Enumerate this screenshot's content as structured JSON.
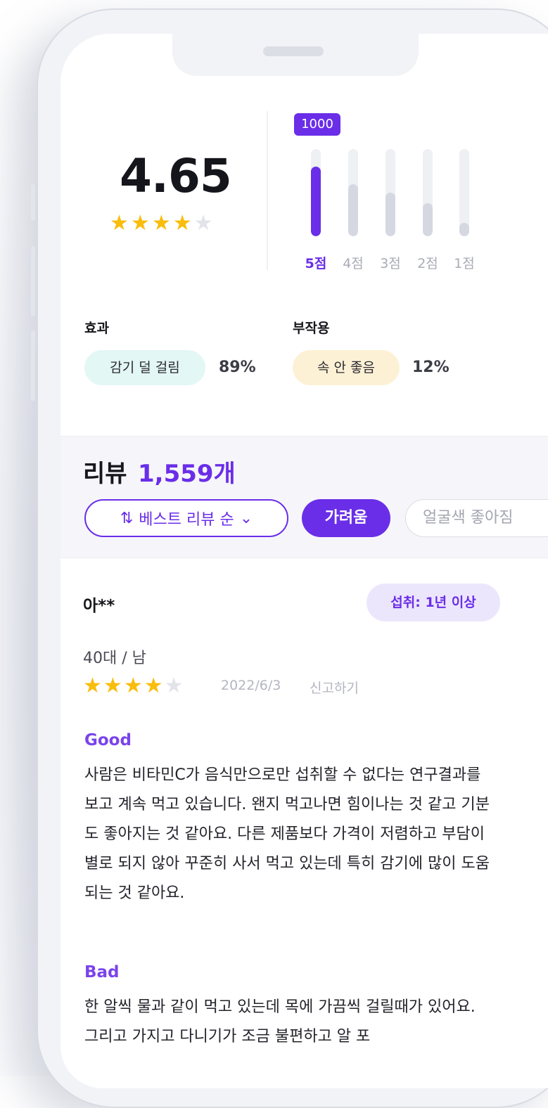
{
  "rating": {
    "score": "4.65",
    "stars_filled": 4,
    "stars_total": 5,
    "top_count_badge": "1000"
  },
  "distribution": [
    {
      "label": "5점",
      "fraction": 0.8,
      "active": true
    },
    {
      "label": "4점",
      "fraction": 0.6,
      "active": false
    },
    {
      "label": "3점",
      "fraction": 0.5,
      "active": false
    },
    {
      "label": "2점",
      "fraction": 0.38,
      "active": false
    },
    {
      "label": "1점",
      "fraction": 0.15,
      "active": false
    }
  ],
  "effects": {
    "effect_title": "효과",
    "effect_chip": "감기 덜 걸림",
    "effect_pct": "89%",
    "side_title": "부작용",
    "side_chip": "속 안 좋음",
    "side_pct": "12%"
  },
  "reviews": {
    "title": "리뷰",
    "count": "1,559개",
    "sort_label": "베스트 리뷰 순",
    "filter_active": "가려움",
    "filter_next": "얼굴색 좋아짐"
  },
  "review": {
    "user": "아**",
    "intake": "섭취: 1년 이상",
    "demographic": "40대 / 남",
    "stars_filled": 4,
    "date": "2022/6/3",
    "report": "신고하기",
    "good_label": "Good",
    "good_text": "사람은 비타민C가 음식만으로만 섭취할 수 없다는 연구결과를 보고 계속 먹고 있습니다. 왠지 먹고나면 힘이나는 것 같고 기분도 좋아지는 것 같아요. 다른 제품보다 가격이 저렴하고 부담이 별로 되지 않아 꾸준히 사서 먹고 있는데 특히 감기에 많이 도움되는 것 같아요.",
    "bad_label": "Bad",
    "bad_text": "한 알씩 물과 같이 먹고 있는데 목에 가끔씩 걸릴때가 있어요. 그리고 가지고 다니기가 조금 불편하고 알 포"
  },
  "colors": {
    "accent": "#6a2ee8",
    "star": "#f9bd0d",
    "effect_bg": "#e3f7f5",
    "side_bg": "#fdf1d5"
  }
}
